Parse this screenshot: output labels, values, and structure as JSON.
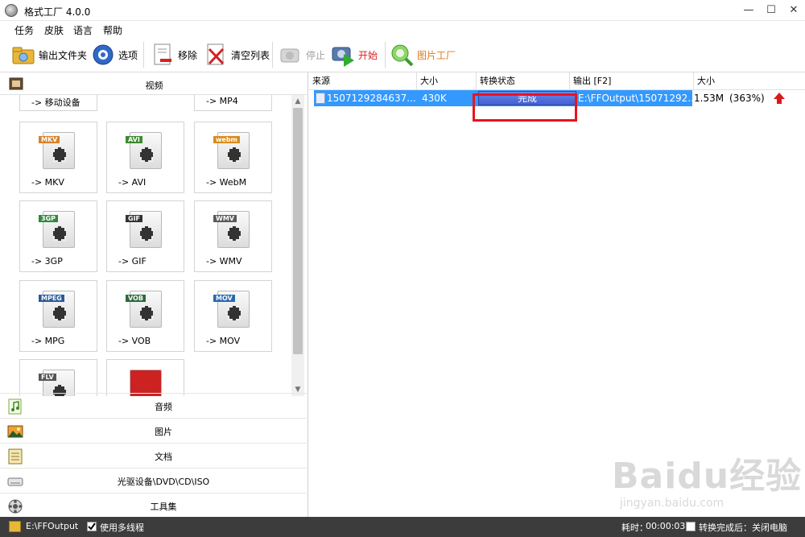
{
  "window": {
    "title": "格式工厂 4.0.0",
    "min": "—",
    "max": "☐",
    "close": "✕"
  },
  "menu": [
    "任务",
    "皮肤",
    "语言",
    "帮助"
  ],
  "toolbar": {
    "output_folder": "输出文件夹",
    "options": "选项",
    "remove": "移除",
    "clear": "清空列表",
    "stop": "停止",
    "start": "开始",
    "picture_factory": "图片工厂"
  },
  "left": {
    "video_header": "视频",
    "partial_tiles": [
      "-> 移动设备",
      "-> MP4"
    ],
    "tiles": [
      {
        "label": "-> MKV",
        "tag": "MKV",
        "color": "#d9822b"
      },
      {
        "label": "-> AVI",
        "tag": "AVI",
        "color": "#3c8a2e"
      },
      {
        "label": "-> WebM",
        "tag": "webm",
        "color": "#d98c1f"
      },
      {
        "label": "-> 3GP",
        "tag": "3GP",
        "color": "#2e8a3c"
      },
      {
        "label": "-> GIF",
        "tag": "GIF",
        "color": "#333333"
      },
      {
        "label": "-> WMV",
        "tag": "WMV",
        "color": "#5a5a5a"
      },
      {
        "label": "-> MPG",
        "tag": "MPEG",
        "color": "#2a5a9a"
      },
      {
        "label": "-> VOB",
        "tag": "VOB",
        "color": "#2e6a3c"
      },
      {
        "label": "-> MOV",
        "tag": "MOV",
        "color": "#2a6ab0"
      },
      {
        "label": "",
        "tag": "FLV",
        "color": "#555555"
      },
      {
        "label": "",
        "tag": "",
        "color": "#cc2222"
      }
    ],
    "categories": [
      "音频",
      "图片",
      "文档",
      "光驱设备\\DVD\\CD\\ISO",
      "工具集"
    ]
  },
  "table": {
    "headers": [
      "来源",
      "大小",
      "转换状态",
      "输出 [F2]",
      "大小"
    ],
    "row": {
      "source": "1507129284637...",
      "size": "430K",
      "status": "完成",
      "output": "E:\\FFOutput\\15071292...",
      "out_size": "1.53M",
      "ratio": "(363%)"
    }
  },
  "status": {
    "path": "E:\\FFOutput",
    "multithread": "使用多线程",
    "elapsed_label": "耗时：",
    "elapsed": "00:00:03",
    "after_done": "转换完成后：关闭电脑"
  },
  "watermark": {
    "brand": "Baidu经验",
    "url": "jingyan.baidu.com"
  }
}
